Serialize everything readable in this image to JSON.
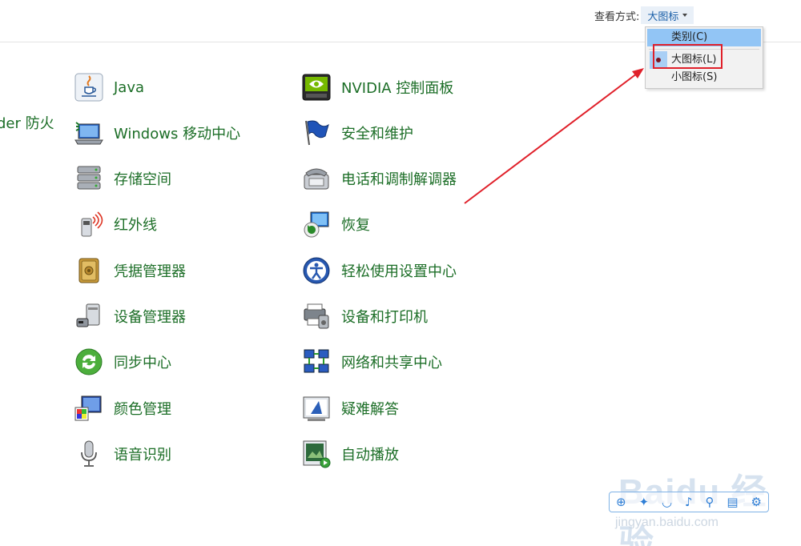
{
  "header": {
    "view_by_label": "查看方式:",
    "view_by_value": "大图标"
  },
  "dropdown": {
    "options": [
      "类别(C)",
      "大图标(L)",
      "小图标(S)"
    ],
    "selected": "大图标(L)"
  },
  "cut_item": {
    "label": "der 防火"
  },
  "items_left": [
    {
      "label": "Java",
      "icon": "java-icon"
    },
    {
      "label": "Windows 移动中心",
      "icon": "mobility-center-icon"
    },
    {
      "label": "存储空间",
      "icon": "storage-spaces-icon"
    },
    {
      "label": "红外线",
      "icon": "infrared-icon"
    },
    {
      "label": "凭据管理器",
      "icon": "credential-manager-icon"
    },
    {
      "label": "设备管理器",
      "icon": "device-manager-icon"
    },
    {
      "label": "同步中心",
      "icon": "sync-center-icon"
    },
    {
      "label": "颜色管理",
      "icon": "color-management-icon"
    },
    {
      "label": "语音识别",
      "icon": "speech-recognition-icon"
    }
  ],
  "items_right": [
    {
      "label": "NVIDIA 控制面板",
      "icon": "nvidia-icon"
    },
    {
      "label": "安全和维护",
      "icon": "security-maintenance-flag-icon"
    },
    {
      "label": "电话和调制解调器",
      "icon": "phone-modem-icon"
    },
    {
      "label": "恢复",
      "icon": "recovery-icon"
    },
    {
      "label": "轻松使用设置中心",
      "icon": "ease-of-access-icon"
    },
    {
      "label": "设备和打印机",
      "icon": "devices-printers-icon"
    },
    {
      "label": "网络和共享中心",
      "icon": "network-sharing-icon"
    },
    {
      "label": "疑难解答",
      "icon": "troubleshooting-icon"
    },
    {
      "label": "自动播放",
      "icon": "autoplay-icon"
    }
  ],
  "watermark": {
    "brand": "Baidu 经验",
    "url": "jingyan.baidu.com"
  },
  "colors": {
    "link_green": "#1c6e27",
    "highlight_blue": "#92c5f5",
    "annotation_red": "#e0202a"
  }
}
